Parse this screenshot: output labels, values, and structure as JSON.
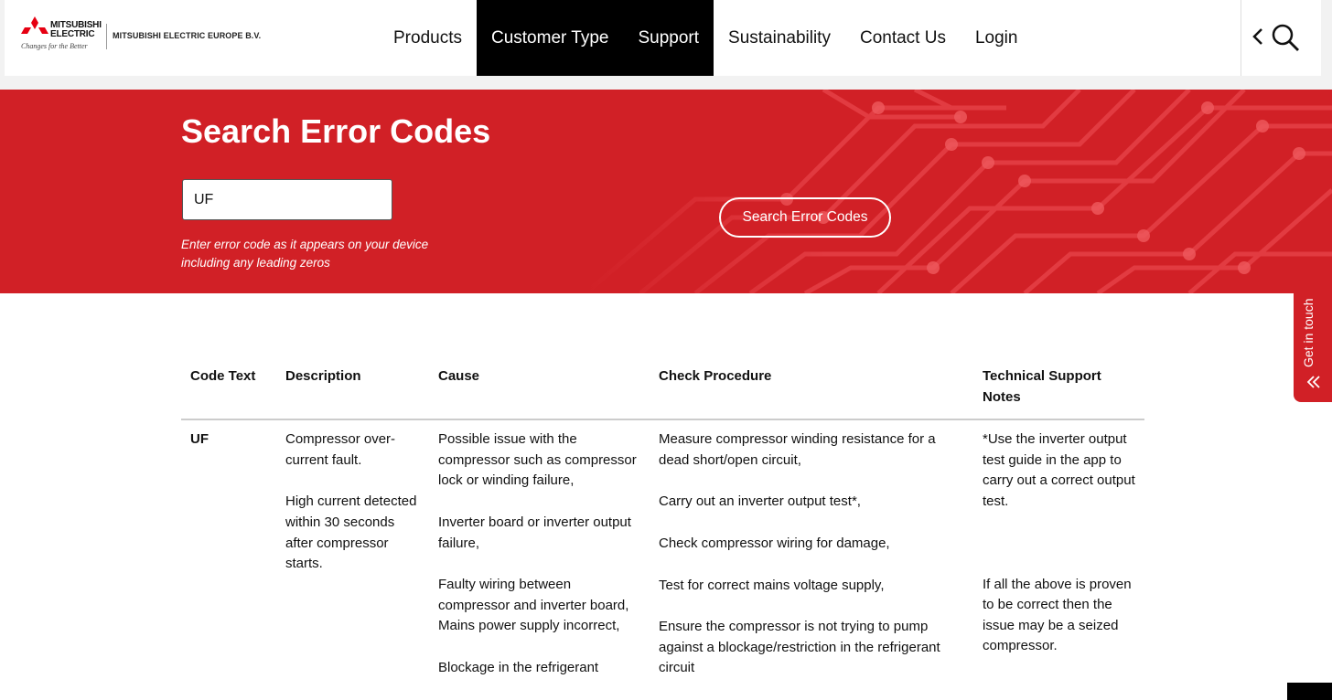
{
  "header": {
    "logo_brand_line1": "MITSUBISHI",
    "logo_brand_line2": "ELECTRIC",
    "logo_tagline": "Changes for the Better",
    "company": "MITSUBISHI  ELECTRIC EUROPE B.V.",
    "nav": [
      {
        "label": "Products",
        "active": false
      },
      {
        "label": "Customer Type",
        "active": true
      },
      {
        "label": "Support",
        "active": true
      },
      {
        "label": "Sustainability",
        "active": false
      },
      {
        "label": "Contact Us",
        "active": false
      },
      {
        "label": "Login",
        "active": false
      }
    ],
    "icons": [
      "chevron-left-icon",
      "search-icon"
    ]
  },
  "hero": {
    "title": "Search Error Codes",
    "input_value": "UF",
    "hint_line1": "Enter error code as it appears on your device",
    "hint_line2": "including any leading zeros",
    "button_label": "Search Error Codes"
  },
  "table": {
    "headers": {
      "code": "Code Text",
      "description": "Description",
      "cause": "Cause",
      "check": "Check Procedure",
      "notes_line1": "Technical Support",
      "notes_line2": "Notes"
    },
    "row": {
      "code": "UF",
      "description": [
        "Compressor over-current fault.",
        "High current detected within 30 seconds after compressor starts."
      ],
      "cause": [
        "Possible issue with the compressor such as compressor lock or winding failure,",
        "Inverter board or inverter output failure,",
        "Faulty wiring between compressor and inverter board, Mains power supply incorrect,",
        "Blockage in the refrigerant"
      ],
      "check": [
        "Measure compressor winding resistance for a dead short/open circuit,",
        "Carry out an inverter output test*,",
        "Check compressor wiring for damage,",
        "Test for correct mains voltage supply,",
        "Ensure the compressor is not trying to pump against a blockage/restriction in the refrigerant circuit"
      ],
      "notes": [
        "*Use the inverter output test guide in the app to carry out a correct output test.",
        "If all the above is proven to be correct then the issue may be a seized compressor."
      ]
    }
  },
  "side_tab": {
    "label": "Get in touch"
  },
  "colors": {
    "brand_red": "#d12026",
    "nav_active_bg": "#000000",
    "text": "#111111"
  }
}
